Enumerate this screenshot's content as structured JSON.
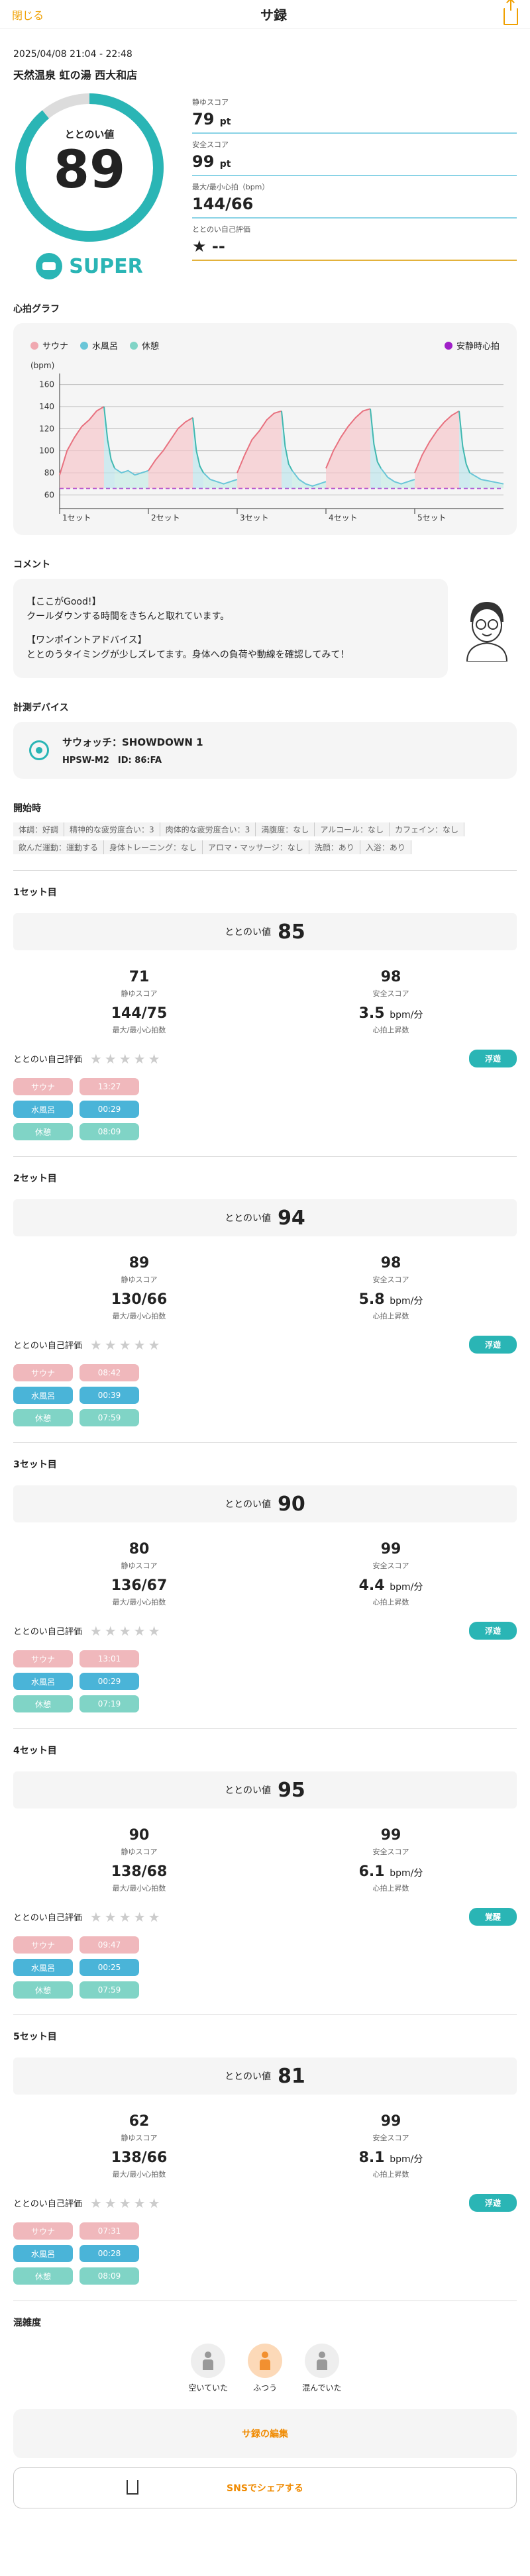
{
  "header": {
    "close": "閉じる",
    "title": "サ録",
    "share_icon": "share-icon"
  },
  "record": {
    "datetime": "2025/04/08 21:04 - 22:48",
    "place": "天然温泉 虹の湯 西大和店"
  },
  "score": {
    "label": "ととのい値",
    "value": "89",
    "rank": "SUPER",
    "gauge_fraction": 0.89
  },
  "stats": [
    {
      "label": "静ゆスコア",
      "value": "79",
      "unit": "pt"
    },
    {
      "label": "安全スコア",
      "value": "99",
      "unit": "pt"
    },
    {
      "label": "最大/最小心拍（bpm）",
      "value": "144/66",
      "unit": ""
    },
    {
      "label": "ととのい自己評価",
      "value": "★ --",
      "unit": ""
    }
  ],
  "heart": {
    "title": "心拍グラフ",
    "legend": {
      "sauna": "サウナ",
      "water": "水風呂",
      "rest": "休憩",
      "safe": "安静時心拍"
    },
    "colors": {
      "sauna": "#e8717f",
      "water": "#40b8b0",
      "rest": "#6ac6d8",
      "safe": "#a020c8"
    },
    "unit": "(bpm)",
    "yticks": [
      "160",
      "140",
      "120",
      "100",
      "80",
      "60"
    ],
    "xticks": [
      "1セット",
      "2セット",
      "3セット",
      "4セット",
      "5セット"
    ]
  },
  "chart_data": {
    "type": "line",
    "ylabel": "(bpm)",
    "ylim": [
      50,
      170
    ],
    "categories": [
      "1セット",
      "2セット",
      "3セット",
      "4セット",
      "5セット"
    ],
    "safe_hr": 66,
    "series": [
      {
        "name": "サウナ",
        "segments": [
          [
            78,
            100,
            112,
            122,
            128,
            136,
            140
          ],
          [
            82,
            92,
            100,
            110,
            120,
            126,
            130
          ],
          [
            80,
            96,
            110,
            118,
            128,
            134,
            136
          ],
          [
            84,
            100,
            112,
            122,
            130,
            136,
            138
          ],
          [
            80,
            96,
            108,
            118,
            126,
            132,
            136
          ]
        ]
      },
      {
        "name": "水風呂",
        "segments": [
          [
            140,
            110,
            92,
            84
          ],
          [
            130,
            100,
            86,
            80
          ],
          [
            136,
            104,
            88,
            82
          ],
          [
            138,
            106,
            90,
            84
          ],
          [
            136,
            104,
            88,
            80
          ]
        ]
      },
      {
        "name": "休憩",
        "segments": [
          [
            84,
            80,
            82,
            78,
            80,
            82
          ],
          [
            80,
            74,
            72,
            70,
            72,
            74
          ],
          [
            82,
            74,
            70,
            68,
            70,
            72
          ],
          [
            84,
            76,
            72,
            70,
            72,
            74
          ],
          [
            80,
            74,
            72,
            70
          ]
        ]
      }
    ]
  },
  "comment": {
    "title": "コメント",
    "lines": [
      "【ここがGood!】",
      "クールダウンする時間をきちんと取れています。",
      "",
      "【ワンポイントアドバイス】",
      "ととのうタイミングが少しズレてます。身体への負荷や動線を確認してみて！"
    ]
  },
  "device": {
    "title": "計測デバイス",
    "name": "サウォッチ：SHOWDOWN 1",
    "model": "HPSW-M2",
    "id_label": "ID:",
    "id": "86:FA"
  },
  "condition": {
    "title": "開始時",
    "tags": [
      "体調：好調",
      "精神的な疲労度合い：3",
      "肉体的な疲労度合い：3",
      "満腹度：なし",
      "アルコール：なし",
      "カフェイン：なし",
      "飲んだ運動：運動する",
      "身体トレーニング：なし",
      "アロマ・マッサージ：なし",
      "洗顔：あり",
      "入浴：あり"
    ]
  },
  "sets": [
    {
      "title": "1セット目",
      "score": "85",
      "calm": "71",
      "safe": "98",
      "hr": "144/75",
      "rise": "3.5",
      "badge": "浮遊",
      "times": [
        "13:27",
        "00:29",
        "08:09"
      ]
    },
    {
      "title": "2セット目",
      "score": "94",
      "calm": "89",
      "safe": "98",
      "hr": "130/66",
      "rise": "5.8",
      "badge": "浮遊",
      "times": [
        "08:42",
        "00:39",
        "07:59"
      ]
    },
    {
      "title": "3セット目",
      "score": "90",
      "calm": "80",
      "safe": "99",
      "hr": "136/67",
      "rise": "4.4",
      "badge": "浮遊",
      "times": [
        "13:01",
        "00:29",
        "07:19"
      ]
    },
    {
      "title": "4セット目",
      "score": "95",
      "calm": "90",
      "safe": "99",
      "hr": "138/68",
      "rise": "6.1",
      "badge": "覚醒",
      "times": [
        "09:47",
        "00:25",
        "07:59"
      ]
    },
    {
      "title": "5セット目",
      "score": "81",
      "calm": "62",
      "safe": "99",
      "hr": "138/66",
      "rise": "8.1",
      "badge": "浮遊",
      "times": [
        "07:31",
        "00:28",
        "08:09"
      ]
    }
  ],
  "set_labels": {
    "score": "ととのい値",
    "calm": "静ゆスコア",
    "safe": "安全スコア",
    "hr": "最大/最小心拍数",
    "rise": "心拍上昇数",
    "rise_unit": "bpm/分",
    "self": "ととのい自己評価",
    "sauna": "サウナ",
    "water": "水風呂",
    "rest": "休憩"
  },
  "crowd": {
    "title": "混雑度",
    "options": [
      {
        "label": "空いていた"
      },
      {
        "label": "ふつう"
      },
      {
        "label": "混んでいた"
      }
    ],
    "selected": 1
  },
  "buttons": {
    "edit": "サ録の編集",
    "share": "SNSでシェアする"
  }
}
